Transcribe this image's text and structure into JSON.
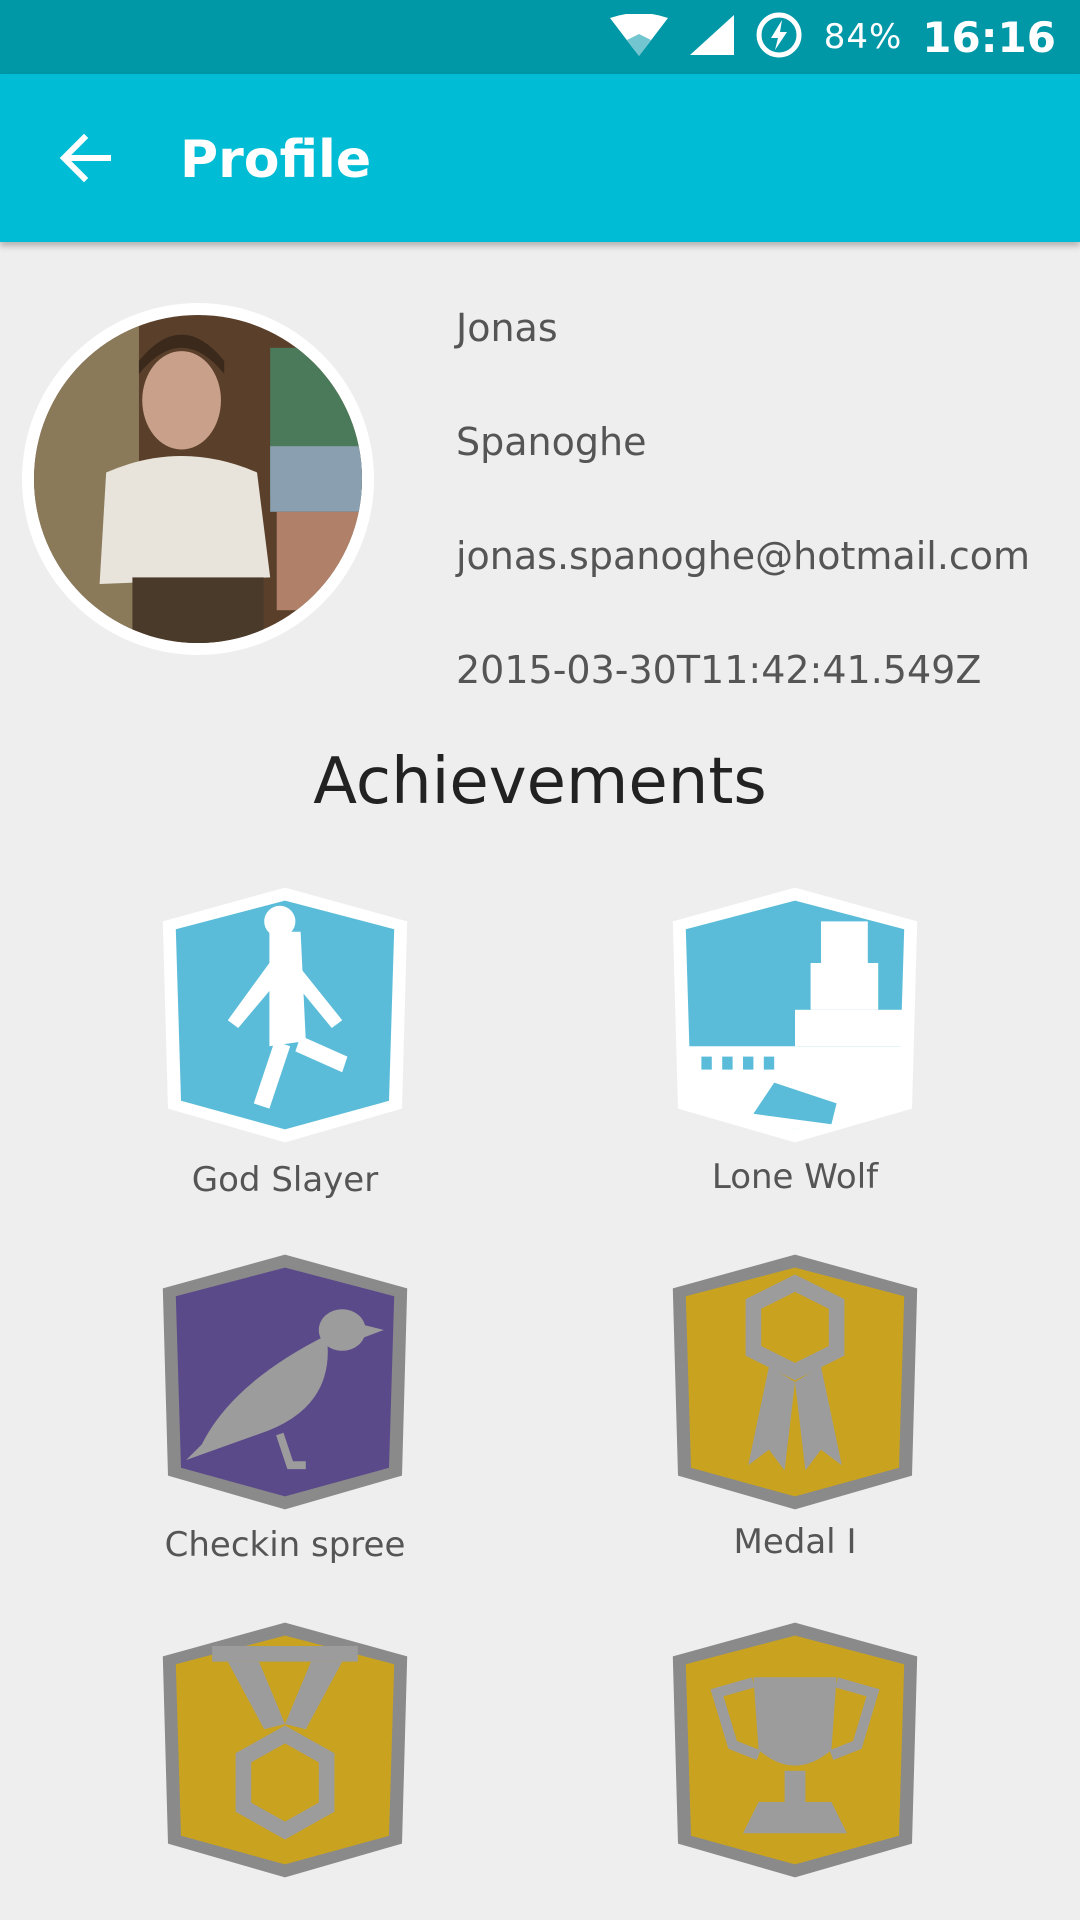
{
  "status_bar": {
    "battery_percent": "84%",
    "time": "16:16",
    "icons": [
      "wifi-icon",
      "cell-signal-icon",
      "battery-charging-icon"
    ]
  },
  "app_bar": {
    "title": "Profile",
    "back_icon": "arrow-left-icon"
  },
  "profile": {
    "first_name": "Jonas",
    "last_name": "Spanoghe",
    "email": "jonas.spanoghe@hotmail.com",
    "created": "2015-03-30T11:42:41.549Z"
  },
  "achievements": {
    "heading": "Achievements",
    "items": [
      {
        "label": "God Slayer",
        "icon": "breakdancer-icon",
        "color": "#5bbcd9"
      },
      {
        "label": "Lone Wolf",
        "icon": "castle-icon",
        "color": "#5bbcd9"
      },
      {
        "label": "Checkin spree",
        "icon": "bird-icon",
        "color": "#5b4a8a"
      },
      {
        "label": "Medal I",
        "icon": "rosette-icon",
        "color": "#c9a320"
      },
      {
        "label": "",
        "icon": "medal-icon",
        "color": "#c9a320"
      },
      {
        "label": "",
        "icon": "trophy-icon",
        "color": "#c9a320"
      }
    ]
  },
  "colors": {
    "status_bar": "#0097a7",
    "app_bar": "#00bcd4",
    "background": "#eeeeee"
  }
}
